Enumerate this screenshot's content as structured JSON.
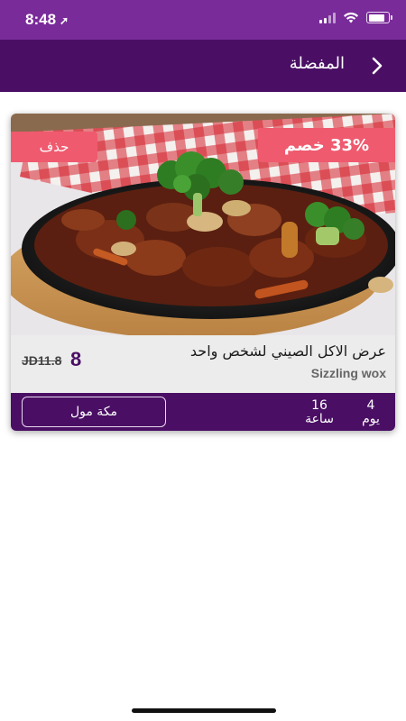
{
  "status_bar": {
    "time": "8:48",
    "location_glyph": "➚",
    "icons": [
      "signal-icon",
      "wifi-icon",
      "battery-icon"
    ],
    "battery_level": 0.85
  },
  "header": {
    "title": "المفضلة",
    "back_icon": "chevron-right-icon"
  },
  "offer": {
    "discount": "33% خصم",
    "delete_label": "حذف",
    "title": "عرض الاكل الصيني لشخص واحد",
    "restaurant": "Sizzling wox",
    "price_new": "8",
    "price_old": "JD11.8",
    "location": "مكة مول",
    "countdown": {
      "days_value": "4",
      "days_label": "يوم",
      "hours_value": "16",
      "hours_label": "ساعة"
    }
  },
  "colors": {
    "status_bar": "#7a2b9a",
    "header": "#4a0f64",
    "badge": "#ef5a6f",
    "info_bg": "#ececec"
  }
}
